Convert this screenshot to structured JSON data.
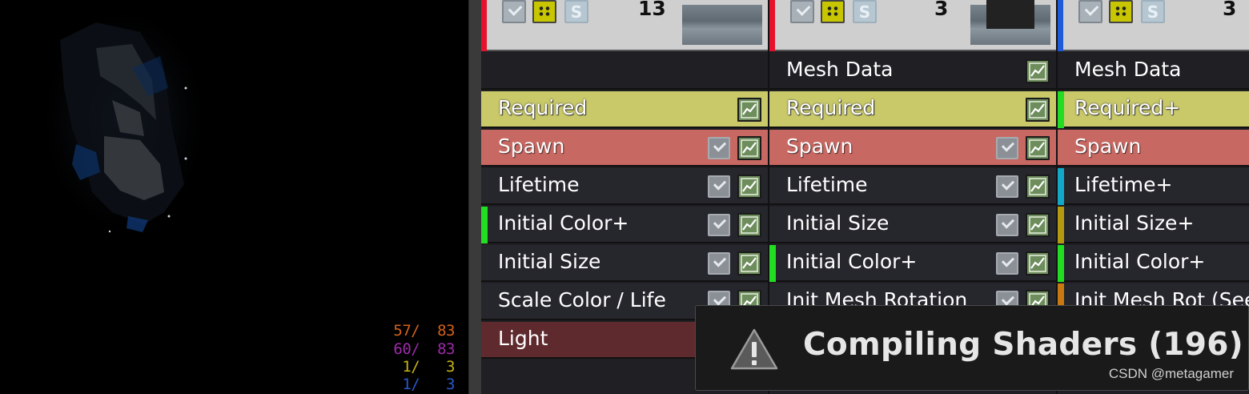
{
  "viewport": {
    "stats": [
      {
        "text": "57/  83",
        "color": "#d2621a"
      },
      {
        "text": "60/  83",
        "color": "#9c2aa8"
      },
      {
        "text": "1/   3",
        "color": "#c5b21c"
      },
      {
        "text": "1/   3",
        "color": "#2a58c8"
      }
    ]
  },
  "emitters": [
    {
      "color": "#e8102a",
      "count": "13",
      "modules": [
        {
          "label": "",
          "style": "meshdata",
          "checkbox": false,
          "curve": false,
          "side": null
        },
        {
          "label": "Required",
          "style": "required",
          "checkbox": false,
          "curve": true,
          "side": null
        },
        {
          "label": "Spawn",
          "style": "spawn",
          "checkbox": true,
          "curve": true,
          "side": null
        },
        {
          "label": "Lifetime",
          "style": "default",
          "checkbox": true,
          "curve": true,
          "side": null
        },
        {
          "label": "Initial Color+",
          "style": "default",
          "checkbox": true,
          "curve": true,
          "side": "#22dd22"
        },
        {
          "label": "Initial Size",
          "style": "default",
          "checkbox": true,
          "curve": true,
          "side": null
        },
        {
          "label": "Scale Color / Life",
          "style": "default",
          "checkbox": true,
          "curve": true,
          "side": null
        },
        {
          "label": "Light",
          "style": "light",
          "checkbox": false,
          "curve": false,
          "side": null
        }
      ]
    },
    {
      "color": "#e8102a",
      "count": "3",
      "modules": [
        {
          "label": "Mesh Data",
          "style": "meshdata",
          "checkbox": false,
          "curve": true,
          "side": null
        },
        {
          "label": "Required",
          "style": "required",
          "checkbox": false,
          "curve": true,
          "side": null
        },
        {
          "label": "Spawn",
          "style": "spawn",
          "checkbox": true,
          "curve": true,
          "side": null
        },
        {
          "label": "Lifetime",
          "style": "default",
          "checkbox": true,
          "curve": true,
          "side": null
        },
        {
          "label": "Initial Size",
          "style": "default",
          "checkbox": true,
          "curve": true,
          "side": null
        },
        {
          "label": "Initial Color+",
          "style": "default",
          "checkbox": true,
          "curve": true,
          "side": "#22dd22"
        },
        {
          "label": "Init Mesh Rotation",
          "style": "default",
          "checkbox": true,
          "curve": true,
          "side": null
        },
        {
          "label": "",
          "style": "default",
          "checkbox": false,
          "curve": false,
          "side": null
        }
      ]
    },
    {
      "color": "#1f5ad8",
      "count": "3",
      "modules": [
        {
          "label": "Mesh Data",
          "style": "meshdata",
          "checkbox": false,
          "curve": false,
          "side": null
        },
        {
          "label": "Required+",
          "style": "required",
          "checkbox": false,
          "curve": false,
          "side": "#22dd22"
        },
        {
          "label": "Spawn",
          "style": "spawn",
          "checkbox": false,
          "curve": false,
          "side": null
        },
        {
          "label": "Lifetime+",
          "style": "default",
          "checkbox": false,
          "curve": false,
          "side": "#14a8c8"
        },
        {
          "label": "Initial Size+",
          "style": "default",
          "checkbox": false,
          "curve": false,
          "side": "#b49a10"
        },
        {
          "label": "Initial Color+",
          "style": "default",
          "checkbox": false,
          "curve": false,
          "side": "#22dd22"
        },
        {
          "label": "Init Mesh Rot (See",
          "style": "default",
          "checkbox": false,
          "curve": false,
          "side": "#c87a10"
        },
        {
          "label": "",
          "style": "default",
          "checkbox": false,
          "curve": false,
          "side": "#14a8c8"
        }
      ]
    }
  ],
  "toast": {
    "text": "Compiling Shaders (196)",
    "icon": "warning-icon"
  },
  "watermark": "CSDN @metagamer"
}
